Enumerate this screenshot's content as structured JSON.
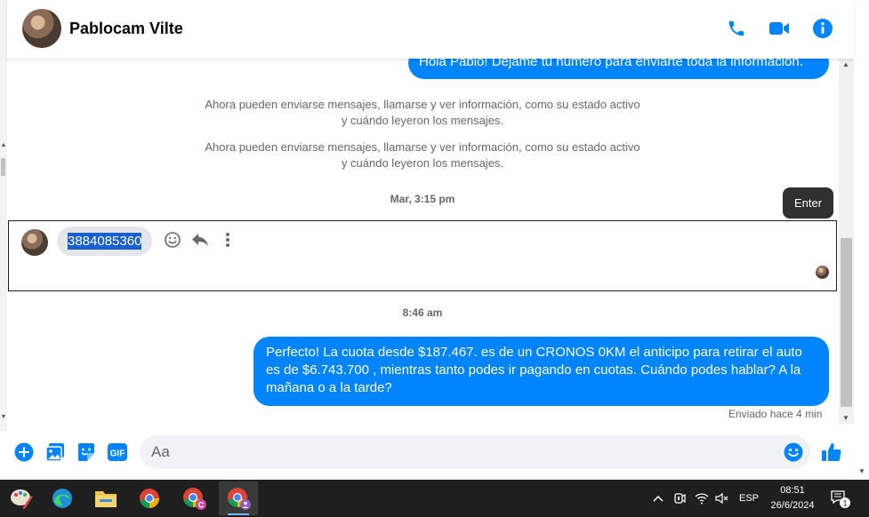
{
  "header": {
    "contact_name": "Pablocam Vilte",
    "icons": [
      "phone-icon",
      "video-icon",
      "info-icon"
    ],
    "accent": "#0084ff"
  },
  "messages": {
    "top_outgoing": "Hola Pablo! Déjame tu número  para enviarte toda la información.",
    "system_1": "Ahora pueden enviarse mensajes, llamarse y ver información, como su estado activo y cuándo leyeron los mensajes.",
    "system_2": "Ahora pueden enviarse mensajes, llamarse y ver información, como su estado activo y cuándo leyeron los mensajes.",
    "timestamp_1": "Mar, 3:15 pm",
    "tooltip": "Enter",
    "incoming_number": "3884085360",
    "timestamp_2": "8:46 am",
    "outgoing_reply": "Perfecto! La cuota desde $187.467. es de un CRONOS 0KM el anticipo para retirar el auto es de $6.743.700 , mientras tanto podes ir pagando en cuotas. Cuándo podes hablar? A la mañana o a la tarde?",
    "sent_status": "Enviado hace 4 min"
  },
  "composer": {
    "placeholder": "Aa",
    "icons": [
      "plus-icon",
      "photo-icon",
      "sticker-icon",
      "gif-icon",
      "emoji-icon",
      "thumbs-up-icon"
    ],
    "gif_label": "GIF"
  },
  "taskbar": {
    "apps": [
      "paint-icon",
      "edge-icon",
      "file-explorer-icon",
      "chrome-icon",
      "chrome-profile-c-icon",
      "chrome-profile-active-icon"
    ],
    "language": "ESP",
    "time": "08:51",
    "date": "26/6/2024",
    "notification_count": "1"
  }
}
